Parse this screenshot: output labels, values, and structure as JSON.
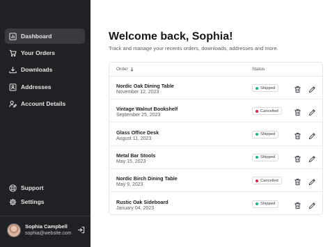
{
  "colors": {
    "sidebar_bg": "#202124",
    "active_nav_bg": "#3a3b40",
    "shipped_dot": "#10b981",
    "cancelled_dot": "#e11d48"
  },
  "sidebar": {
    "nav": [
      {
        "label": "Dashboard",
        "icon": "chart-icon",
        "active": true
      },
      {
        "label": "Your Orders",
        "icon": "cart-icon",
        "active": false
      },
      {
        "label": "Downloads",
        "icon": "download-icon",
        "active": false
      },
      {
        "label": "Addresses",
        "icon": "address-book-icon",
        "active": false
      },
      {
        "label": "Account Details",
        "icon": "user-edit-icon",
        "active": false
      }
    ],
    "bottom_nav": [
      {
        "label": "Support",
        "icon": "lifebuoy-icon"
      },
      {
        "label": "Settings",
        "icon": "gear-icon"
      }
    ],
    "user": {
      "name": "Sophia Campbell",
      "email": "sophia@website.com"
    }
  },
  "main": {
    "title": "Welcome back, Sophia!",
    "subtitle": "Track and manage your recents orders, downloads, addresses and more.",
    "table": {
      "headers": {
        "order": "Order",
        "status": "Status"
      },
      "rows": [
        {
          "name": "Nordic Oak Dining Table",
          "date": "November 12, 2023",
          "status": "Shipped"
        },
        {
          "name": "Vintage Walnut Bookshelf",
          "date": "September 25, 2023",
          "status": "Cancelled"
        },
        {
          "name": "Glass Office Desk",
          "date": "August 11, 2023",
          "status": "Shipped"
        },
        {
          "name": "Metal Bar Stools",
          "date": "May 15, 2023",
          "status": "Shipped"
        },
        {
          "name": "Nordic Birch Dining Table",
          "date": "May 9, 2023",
          "status": "Cancelled"
        },
        {
          "name": "Rustic Oak Sideboard",
          "date": "January 04, 2023",
          "status": "Shipped"
        }
      ]
    }
  }
}
